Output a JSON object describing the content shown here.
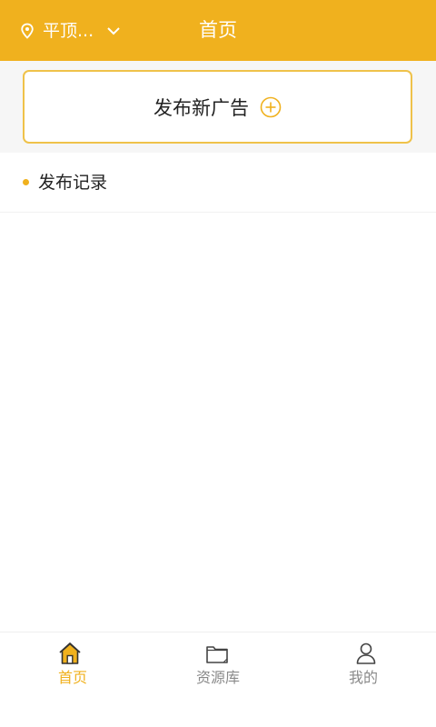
{
  "header": {
    "location": "平顶...",
    "title": "首页",
    "accent_color": "#f0b11e"
  },
  "publish": {
    "label": "发布新广告",
    "icon": "plus-circle-icon"
  },
  "records": {
    "title": "发布记录",
    "items": []
  },
  "tabbar": {
    "tabs": [
      {
        "label": "首页",
        "icon": "home-icon",
        "active": true
      },
      {
        "label": "资源库",
        "icon": "folder-icon",
        "active": false
      },
      {
        "label": "我的",
        "icon": "user-icon",
        "active": false
      }
    ],
    "active_color": "#f0b11e",
    "inactive_color": "#8a8a8a"
  }
}
